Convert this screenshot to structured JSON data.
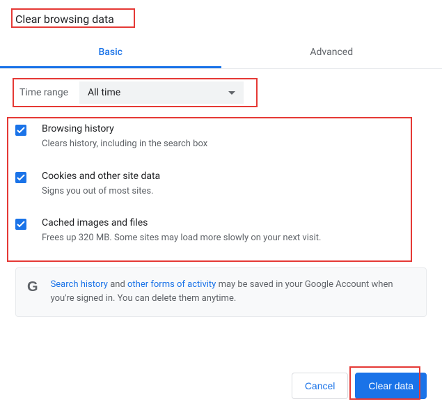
{
  "title": "Clear browsing data",
  "tabs": {
    "basic": "Basic",
    "advanced": "Advanced"
  },
  "range": {
    "label": "Time range",
    "value": "All time"
  },
  "options": [
    {
      "title": "Browsing history",
      "sub": "Clears history, including in the search box"
    },
    {
      "title": "Cookies and other site data",
      "sub": "Signs you out of most sites."
    },
    {
      "title": "Cached images and files",
      "sub": "Frees up 320 MB. Some sites may load more slowly on your next visit."
    }
  ],
  "notice": {
    "t1": "Search history",
    "t2": " and ",
    "t3": "other forms of activity",
    "t4": " may be saved in your Google Account when you're signed in. You can delete them anytime."
  },
  "buttons": {
    "cancel": "Cancel",
    "clear": "Clear data"
  }
}
